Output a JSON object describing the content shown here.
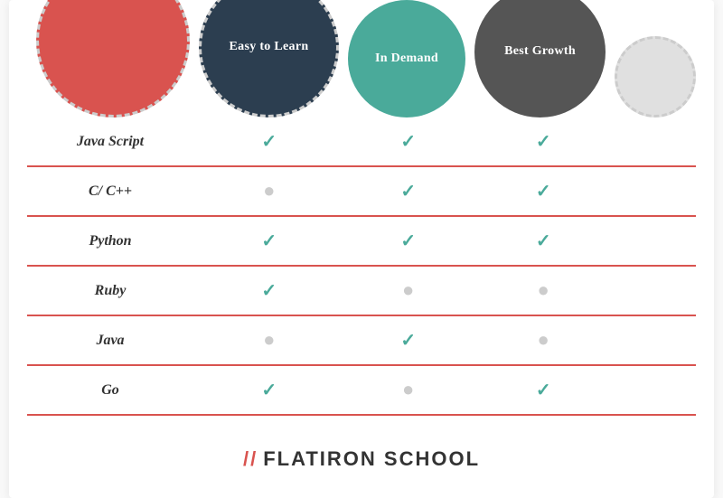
{
  "header": {
    "bubble_lang_label": "",
    "bubble_easy_label": "Easy to Learn",
    "bubble_demand_label": "In Demand",
    "bubble_growth_label": "Best Growth"
  },
  "colors": {
    "red": "#d9534f",
    "dark": "#2c3e50",
    "teal": "#4aaa9a",
    "dark_gray": "#555555",
    "light_gray": "#e0e0e0"
  },
  "table": {
    "columns": [
      "",
      "Easy to Learn",
      "In Demand",
      "Best Growth",
      ""
    ],
    "rows": [
      {
        "lang": "Java Script",
        "easy": "check",
        "demand": "check",
        "growth": "check",
        "red_border": true
      },
      {
        "lang": "C/ C++",
        "easy": "dot",
        "demand": "check",
        "growth": "check",
        "red_border": true
      },
      {
        "lang": "Python",
        "easy": "check",
        "demand": "check",
        "growth": "check",
        "red_border": true
      },
      {
        "lang": "Ruby",
        "easy": "check",
        "demand": "dot",
        "growth": "dot",
        "red_border": true
      },
      {
        "lang": "Java",
        "easy": "dot",
        "demand": "check",
        "growth": "dot",
        "red_border": true
      },
      {
        "lang": "Go",
        "easy": "check",
        "demand": "dot",
        "growth": "check",
        "red_border": true
      }
    ]
  },
  "footer": {
    "slashes": "//",
    "brand": "FLATIRON SCHOOL"
  }
}
